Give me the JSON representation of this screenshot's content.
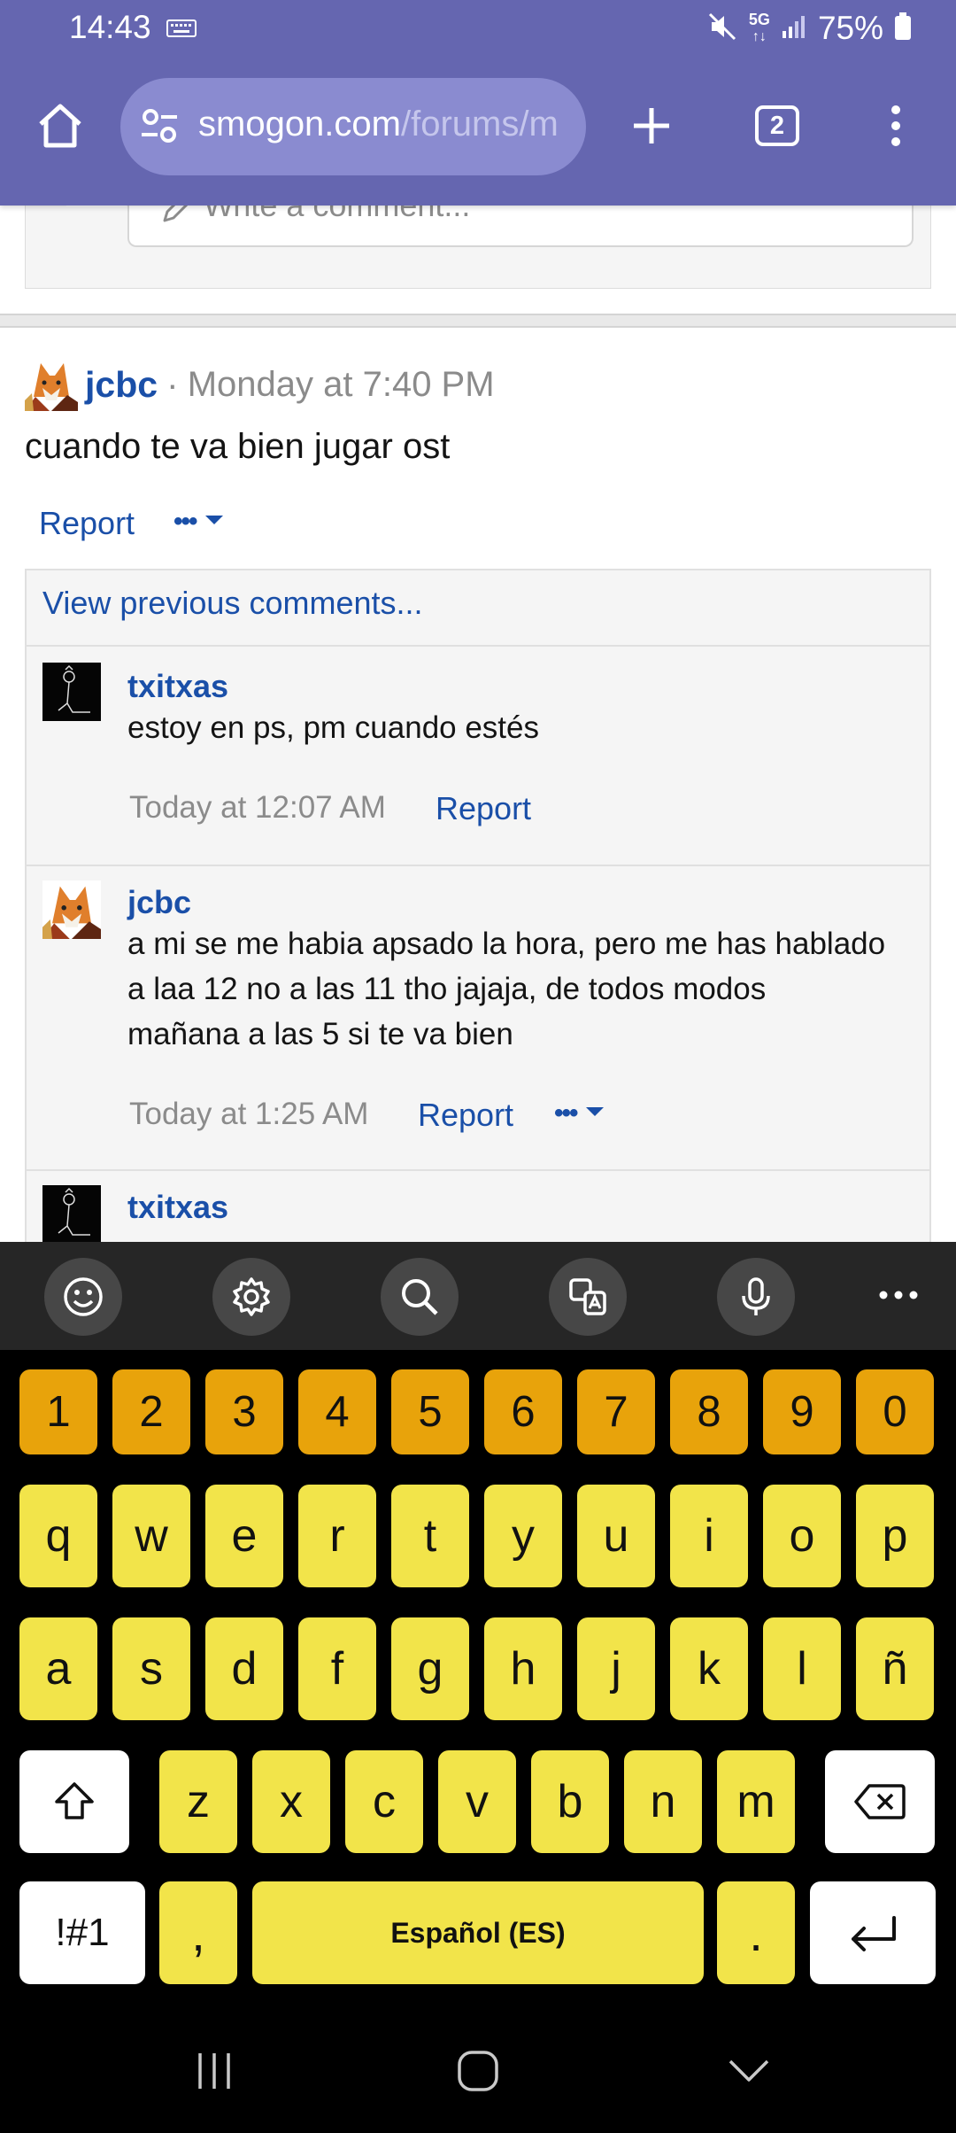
{
  "status_bar": {
    "time": "14:43",
    "network": "5G",
    "battery": "75%"
  },
  "browser": {
    "url_host": "smogon.com",
    "url_path": "/forums/m",
    "tab_count": "2",
    "theme_color": "#6566b0"
  },
  "comment_composer": {
    "placeholder": "Write a comment..."
  },
  "post": {
    "author": "jcbc",
    "separator": "·",
    "time": "Monday at 7:40 PM",
    "body": "cuando te va bien jugar ost",
    "report_label": "Report",
    "more_label": "•••"
  },
  "comments": {
    "view_previous": "View previous comments...",
    "items": [
      {
        "author": "txitxas",
        "text": "estoy en ps, pm cuando estés",
        "time": "Today at 12:07 AM",
        "report": "Report"
      },
      {
        "author": "jcbc",
        "lines": [
          "a mi se me habia apsado la hora, pero me has hablado",
          "a laa 12 no a las 11 tho jajaja, de todos modos",
          "mañana a las 5 si te va bien"
        ],
        "time": "Today at 1:25 AM",
        "report": "Report",
        "more": "•••"
      },
      {
        "author": "txitxas"
      }
    ]
  },
  "keyboard": {
    "toolbar_icons": [
      "emoji-icon",
      "settings-icon",
      "search-icon",
      "translate-icon",
      "microphone-icon",
      "more-icon"
    ],
    "numbers": [
      "1",
      "2",
      "3",
      "4",
      "5",
      "6",
      "7",
      "8",
      "9",
      "0"
    ],
    "row1": [
      "q",
      "w",
      "e",
      "r",
      "t",
      "y",
      "u",
      "i",
      "o",
      "p"
    ],
    "row2": [
      "a",
      "s",
      "d",
      "f",
      "g",
      "h",
      "j",
      "k",
      "l",
      "ñ"
    ],
    "row3": [
      "z",
      "x",
      "c",
      "v",
      "b",
      "n",
      "m"
    ],
    "symbols_key": "!#1",
    "comma_key": ",",
    "space_label": "Español (ES)",
    "period_key": ".",
    "colors": {
      "number_key": "#e8a30b",
      "letter_key": "#f2e44a"
    }
  }
}
